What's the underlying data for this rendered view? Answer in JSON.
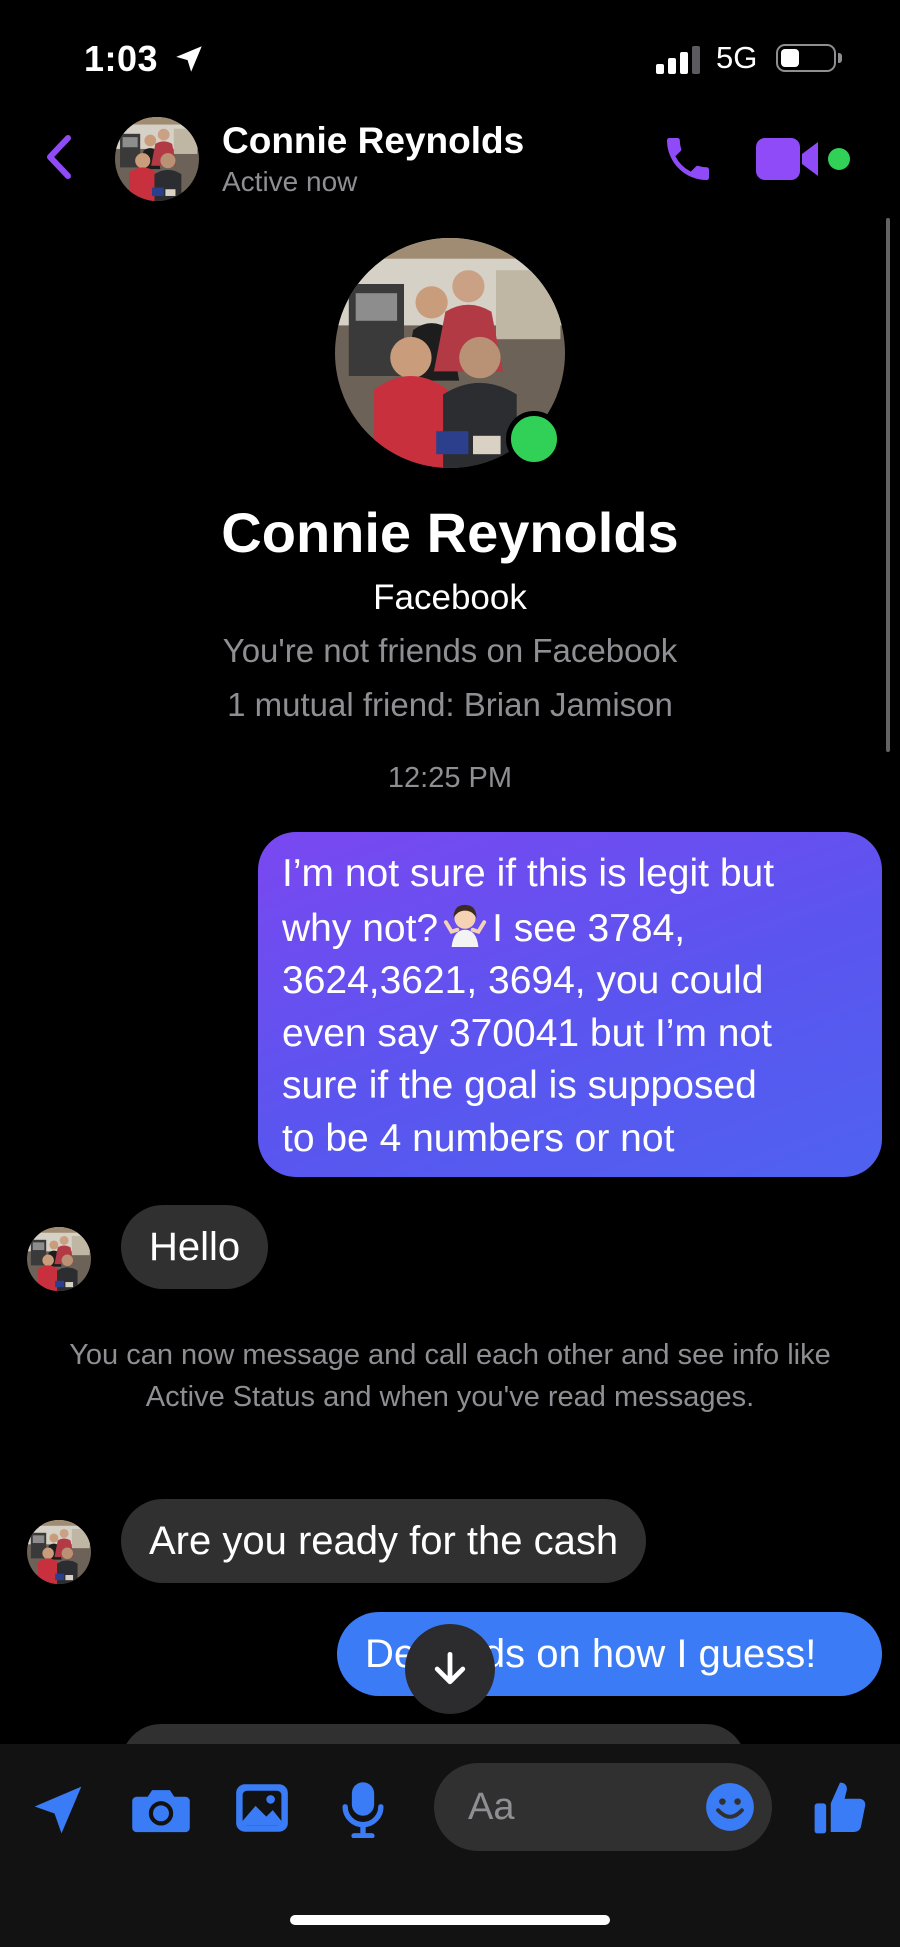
{
  "status_bar": {
    "time": "1:03",
    "network": "5G"
  },
  "header": {
    "name": "Connie Reynolds",
    "status": "Active now"
  },
  "profile": {
    "name": "Connie Reynolds",
    "platform": "Facebook",
    "friend_status": "You're not friends on Facebook",
    "mutual": "1 mutual friend: Brian Jamison"
  },
  "timestamp": "12:25 PM",
  "messages": {
    "m1_lines": [
      "I’m not sure if this is legit but",
      "why not?",
      "I see 3784,",
      "3624,3621, 3694, you could",
      "even say 370041 but I’m not",
      "sure if the goal is supposed",
      "to be 4 numbers or not"
    ],
    "m2": "Hello",
    "system": "You can now message and call each other and see info like Active Status and when you've read messages.",
    "m3": "Are you ready for the cash",
    "m4": "Depends on how I guess!"
  },
  "composer": {
    "placeholder": "Aa"
  },
  "colors": {
    "accent": "#8e4bf7",
    "outgoing_gradient_start": "#7a48f0",
    "outgoing_gradient_end": "#4f62f0",
    "outgoing_blue": "#3b7cf6",
    "incoming": "#303030",
    "toolbar_blue": "#3a7cf5",
    "online": "#31d158"
  }
}
